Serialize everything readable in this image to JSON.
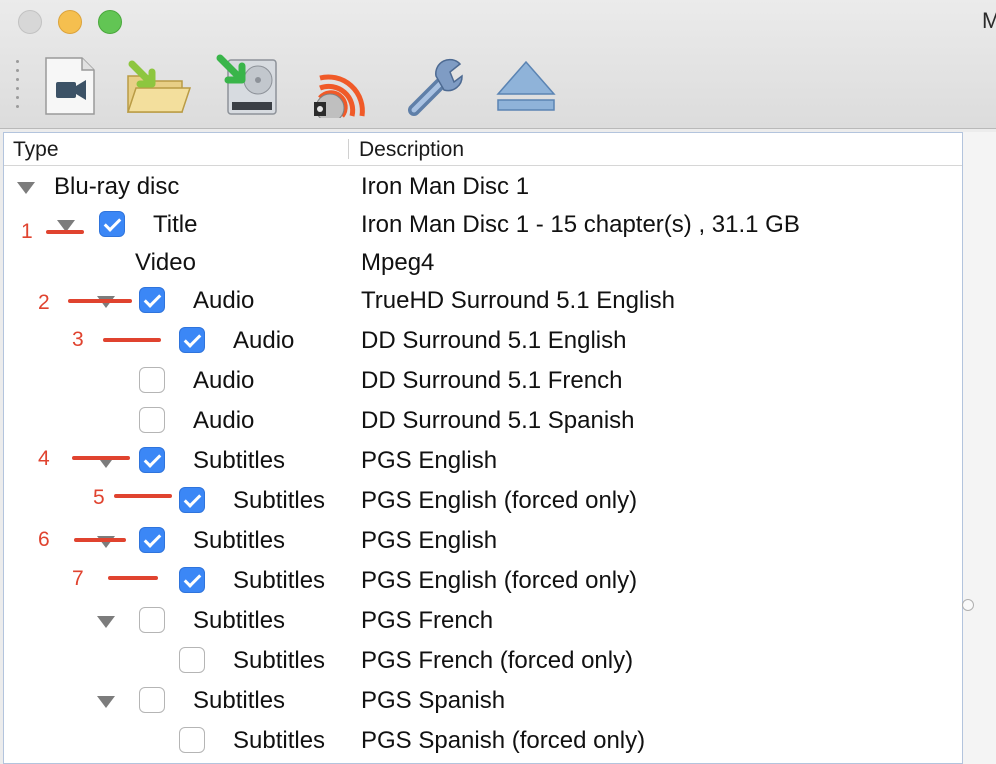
{
  "window": {
    "title_fragment": "M"
  },
  "toolbar": {
    "items": [
      {
        "icon": "video-camera-icon"
      },
      {
        "icon": "open-folder-icon"
      },
      {
        "icon": "drive-import-icon"
      },
      {
        "icon": "stream-disc-icon"
      },
      {
        "icon": "wrench-icon"
      },
      {
        "icon": "eject-icon"
      }
    ]
  },
  "outline": {
    "columns": {
      "type": "Type",
      "description": "Description"
    },
    "rows": [
      {
        "type": "Blu-ray disc",
        "description": "Iron Man Disc 1",
        "disclosure": true,
        "checkbox": null
      },
      {
        "type": "Title",
        "description": "Iron Man Disc 1 - 15 chapter(s) , 31.1 GB",
        "disclosure": true,
        "checkbox": true
      },
      {
        "type": "Video",
        "description": "Mpeg4",
        "disclosure": false,
        "checkbox": null
      },
      {
        "type": "Audio",
        "description": "TrueHD Surround 5.1 English",
        "disclosure": true,
        "checkbox": true
      },
      {
        "type": "Audio",
        "description": "DD Surround 5.1 English",
        "disclosure": false,
        "checkbox": true
      },
      {
        "type": "Audio",
        "description": "DD Surround 5.1 French",
        "disclosure": false,
        "checkbox": false
      },
      {
        "type": "Audio",
        "description": "DD Surround 5.1 Spanish",
        "disclosure": false,
        "checkbox": false
      },
      {
        "type": "Subtitles",
        "description": "PGS English",
        "disclosure": true,
        "checkbox": true
      },
      {
        "type": "Subtitles",
        "description": "PGS English  (forced only)",
        "disclosure": false,
        "checkbox": true
      },
      {
        "type": "Subtitles",
        "description": "PGS English",
        "disclosure": true,
        "checkbox": true
      },
      {
        "type": "Subtitles",
        "description": "PGS English  (forced only)",
        "disclosure": false,
        "checkbox": true
      },
      {
        "type": "Subtitles",
        "description": "PGS French",
        "disclosure": true,
        "checkbox": false
      },
      {
        "type": "Subtitles",
        "description": "PGS French  (forced only)",
        "disclosure": false,
        "checkbox": false
      },
      {
        "type": "Subtitles",
        "description": "PGS Spanish",
        "disclosure": true,
        "checkbox": false
      },
      {
        "type": "Subtitles",
        "description": "PGS Spanish  (forced only)",
        "disclosure": false,
        "checkbox": false
      }
    ]
  },
  "annotations": {
    "numbers": [
      "1",
      "2",
      "3",
      "4",
      "5",
      "6",
      "7"
    ],
    "color": "#e0432f"
  },
  "colors": {
    "checkbox_on": "#3b87f6",
    "accent_annotation": "#e0432f"
  }
}
